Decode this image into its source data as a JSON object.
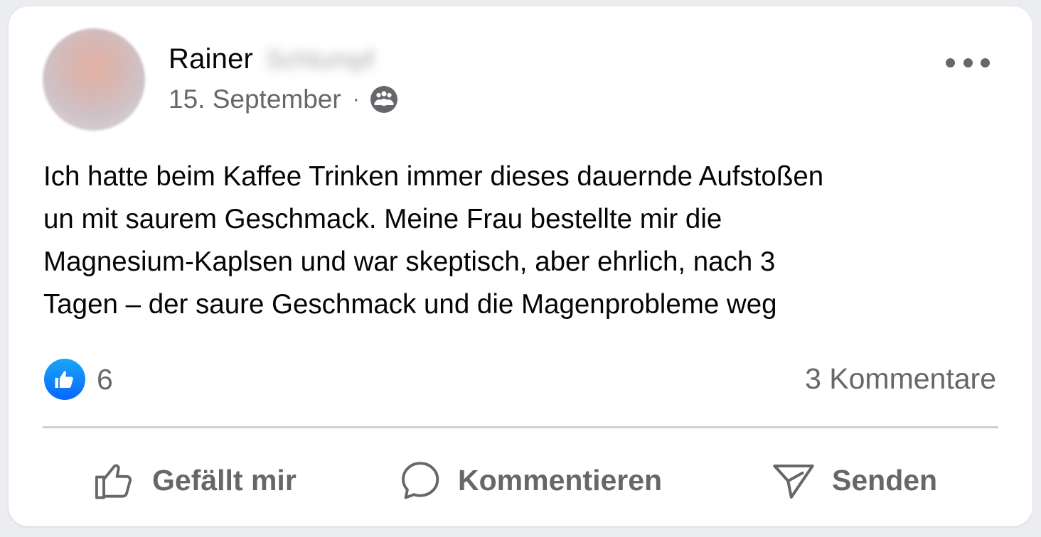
{
  "post": {
    "author_first_name": "Rainer",
    "author_surname_blurred": "Schlumpf",
    "date": "15. September",
    "separator": "·",
    "audience_icon": "group-icon",
    "text_lines": [
      "Ich hatte beim Kaffee Trinken immer dieses dauernde Aufstoßen",
      "un mit saurem Geschmack. Meine Frau bestellte mir die",
      "Magnesium-Kaplsen und war skeptisch, aber ehrlich, nach 3",
      "Tagen – der saure Geschmack und die Magenprobleme weg"
    ]
  },
  "stats": {
    "reaction_icon": "like-reaction-icon",
    "reaction_count": "6",
    "comments": "3 Kommentare"
  },
  "actions": {
    "like_label": "Gefällt mir",
    "comment_label": "Kommentieren",
    "send_label": "Senden"
  },
  "colors": {
    "text_primary": "#050505",
    "text_secondary": "#65676b",
    "like_blue": "#0866ff",
    "divider": "#ced0d4",
    "background": "#ffffff"
  }
}
